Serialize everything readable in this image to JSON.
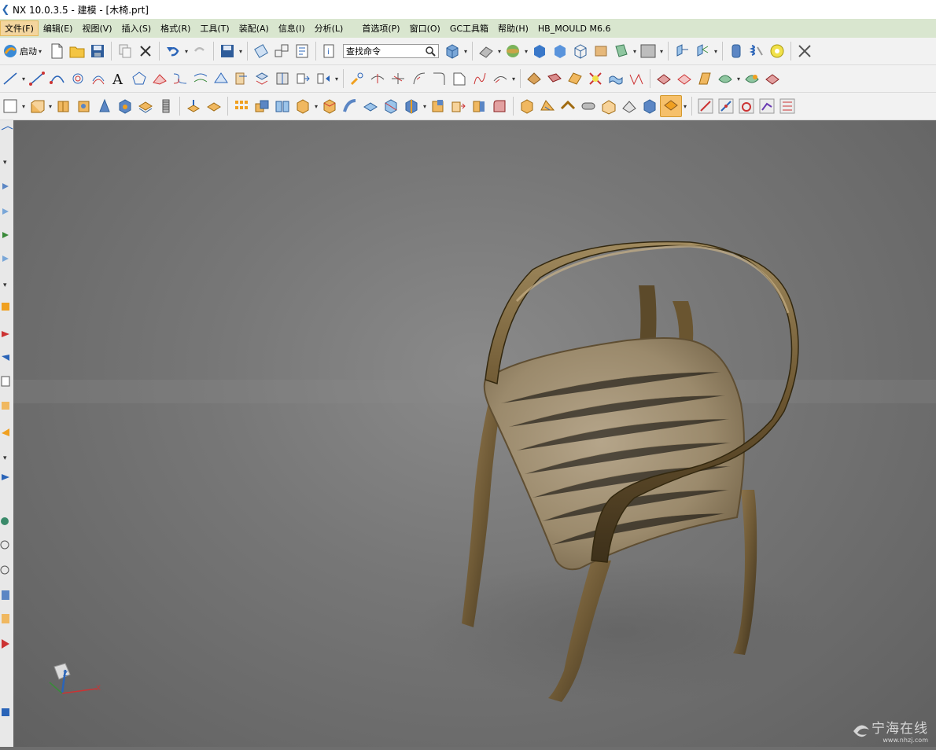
{
  "titlebar": {
    "title": "NX 10.0.3.5 - 建模 - [木椅.prt]"
  },
  "menu": [
    {
      "label": "文件(F)",
      "active": true
    },
    {
      "label": "编辑(E)"
    },
    {
      "label": "视图(V)"
    },
    {
      "label": "插入(S)"
    },
    {
      "label": "格式(R)"
    },
    {
      "label": "工具(T)"
    },
    {
      "label": "装配(A)"
    },
    {
      "label": "信息(I)"
    },
    {
      "label": "分析(L)"
    },
    {
      "label": "首选项(P)"
    },
    {
      "label": "窗口(O)"
    },
    {
      "label": "GC工具箱"
    },
    {
      "label": "帮助(H)"
    },
    {
      "label": "HB_MOULD M6.6"
    }
  ],
  "toolbar": {
    "start_label": "启动",
    "search_placeholder": "查找命令"
  },
  "watermark": {
    "name": "宁海在线",
    "url": "www.nhzj.com"
  },
  "triad": {
    "z": "Z",
    "x": "X"
  },
  "colors": {
    "menubar": "#d9e6cf",
    "viewport": "#6e6e6e",
    "wood": "#8a7352"
  }
}
